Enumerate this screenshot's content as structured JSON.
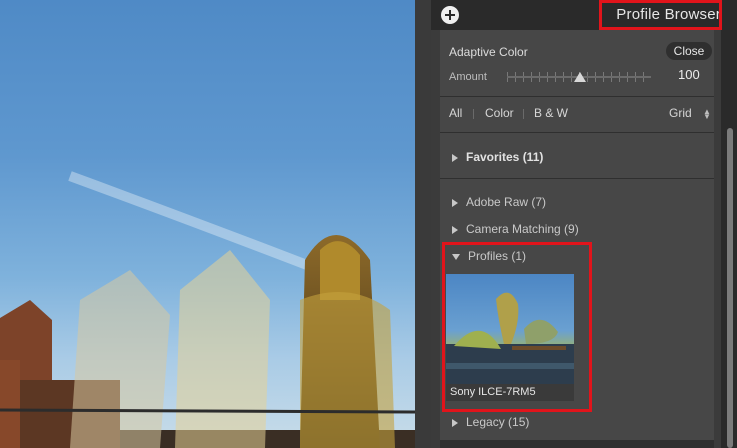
{
  "panel": {
    "title": "Profile Browser",
    "adaptive_color_label": "Adaptive Color",
    "close_label": "Close",
    "amount_label": "Amount",
    "amount_value": "100",
    "tabs": [
      "All",
      "Color",
      "B & W"
    ],
    "view_label": "Grid",
    "sections": [
      {
        "label": "Favorites (11)"
      },
      {
        "label": "Adobe Raw (7)"
      },
      {
        "label": "Camera Matching (9)"
      },
      {
        "label": "Profiles (1)"
      },
      {
        "label": "Legacy (15)"
      }
    ],
    "profile_thumbnail_label": "Sony ILCE-7RM5"
  }
}
